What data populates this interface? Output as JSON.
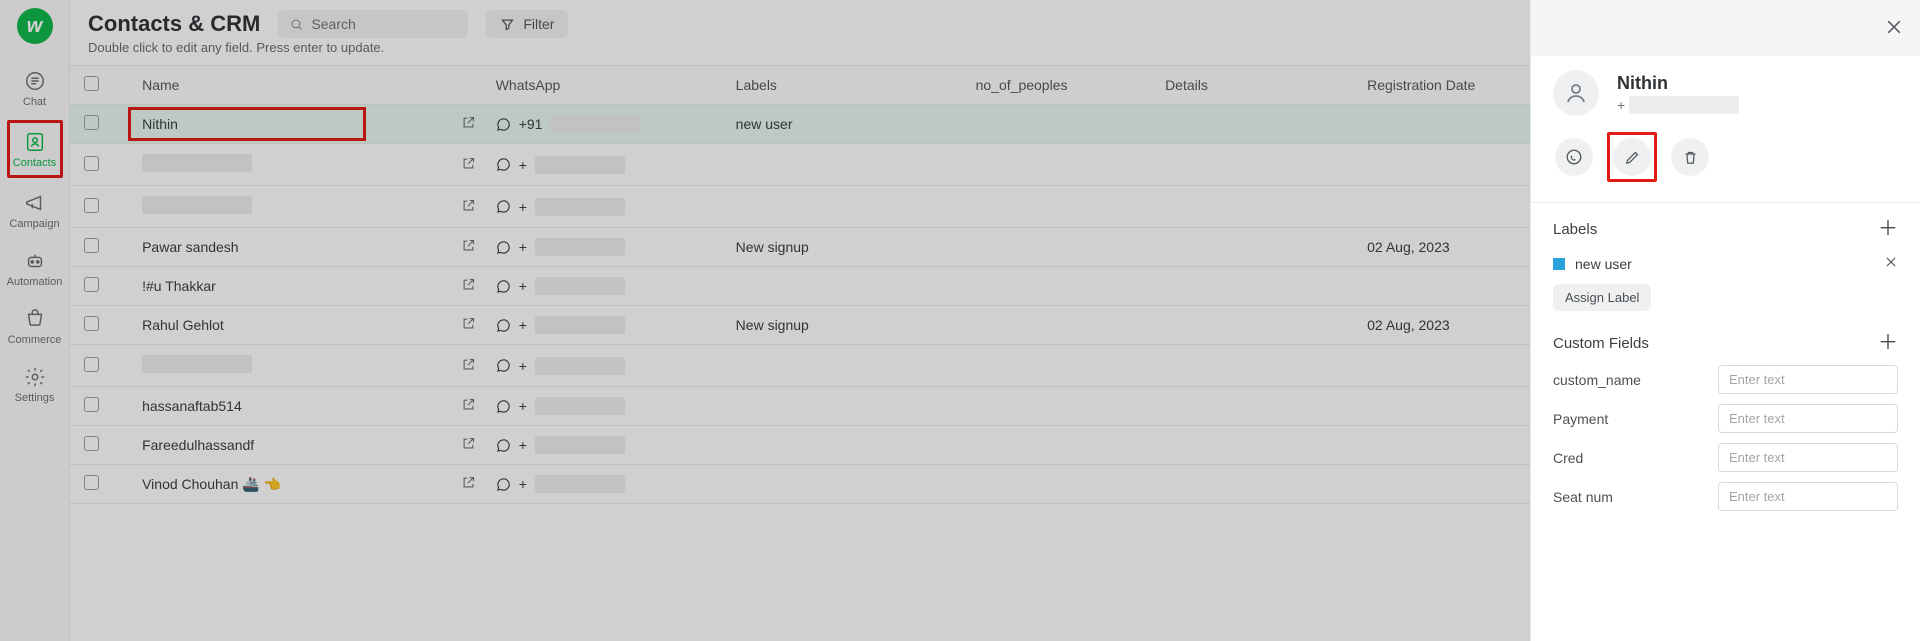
{
  "nav": {
    "items": [
      {
        "key": "chat",
        "label": "Chat"
      },
      {
        "key": "contacts",
        "label": "Contacts"
      },
      {
        "key": "campaign",
        "label": "Campaign"
      },
      {
        "key": "automation",
        "label": "Automation"
      },
      {
        "key": "commerce",
        "label": "Commerce"
      },
      {
        "key": "settings",
        "label": "Settings"
      }
    ]
  },
  "header": {
    "title": "Contacts & CRM",
    "search_placeholder": "Search",
    "filter_label": "Filter",
    "subhead": "Double click to edit any field. Press enter to update."
  },
  "table": {
    "columns": {
      "name": "Name",
      "whatsapp": "WhatsApp",
      "labels": "Labels",
      "no_of_peoples": "no_of_peoples",
      "details": "Details",
      "registration_date": "Registration Date"
    },
    "rows": [
      {
        "name": "Nithin",
        "wa_prefix": "+91",
        "labels": "new user",
        "reg": ""
      },
      {
        "name": "",
        "wa_prefix": "+",
        "labels": "",
        "reg": ""
      },
      {
        "name": "",
        "wa_prefix": "+",
        "labels": "",
        "reg": ""
      },
      {
        "name": "Pawar sandesh",
        "wa_prefix": "+",
        "labels": "New signup",
        "reg": "02 Aug, 2023"
      },
      {
        "name": "!#u Thakkar",
        "wa_prefix": "+",
        "labels": "",
        "reg": ""
      },
      {
        "name": "Rahul Gehlot",
        "wa_prefix": "+",
        "labels": "New signup",
        "reg": "02 Aug, 2023"
      },
      {
        "name": "",
        "wa_prefix": "+",
        "labels": "",
        "reg": ""
      },
      {
        "name": "hassanaftab514",
        "wa_prefix": "+",
        "labels": "",
        "reg": ""
      },
      {
        "name": "Fareedulhassandf",
        "wa_prefix": "+",
        "labels": "",
        "reg": ""
      },
      {
        "name": "Vinod Chouhan 🚢 👈",
        "wa_prefix": "+",
        "labels": "",
        "reg": ""
      }
    ]
  },
  "panel": {
    "contact": {
      "name": "Nithin",
      "phone_prefix": "+"
    },
    "labels_title": "Labels",
    "label_chip": "new user",
    "assign_label": "Assign Label",
    "custom_fields_title": "Custom Fields",
    "placeholder": "Enter text",
    "fields": [
      {
        "label": "custom_name"
      },
      {
        "label": "Payment"
      },
      {
        "label": "Cred"
      },
      {
        "label": "Seat num"
      }
    ]
  }
}
